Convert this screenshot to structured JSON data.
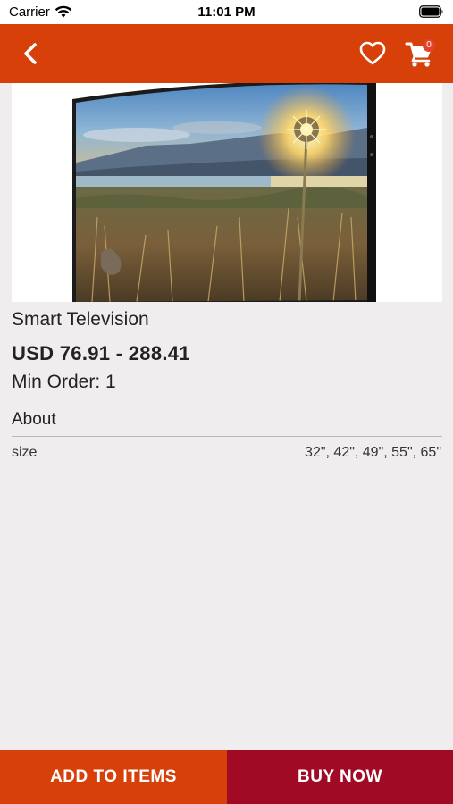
{
  "status_bar": {
    "carrier": "Carrier",
    "time": "11:01 PM",
    "icons": [
      "wifi-icon",
      "battery-icon"
    ]
  },
  "nav": {
    "back_icon": "chevron-left-icon",
    "favorite_icon": "heart-icon",
    "cart_icon": "cart-icon",
    "cart_count": "0",
    "background_color": "#d8400a"
  },
  "product": {
    "image": "tv-landscape-image",
    "title": "Smart Television",
    "price": "USD 76.91 - 288.41",
    "min_order_label": "Min Order:",
    "min_order_value": "1"
  },
  "about": {
    "heading": "About",
    "attributes": [
      {
        "label": "size",
        "value": "32\", 42\", 49\", 55\", 65\""
      }
    ]
  },
  "actions": {
    "add_label": "ADD TO ITEMS",
    "buy_label": "BUY NOW",
    "add_color": "#d8400a",
    "buy_color": "#a00a24"
  }
}
